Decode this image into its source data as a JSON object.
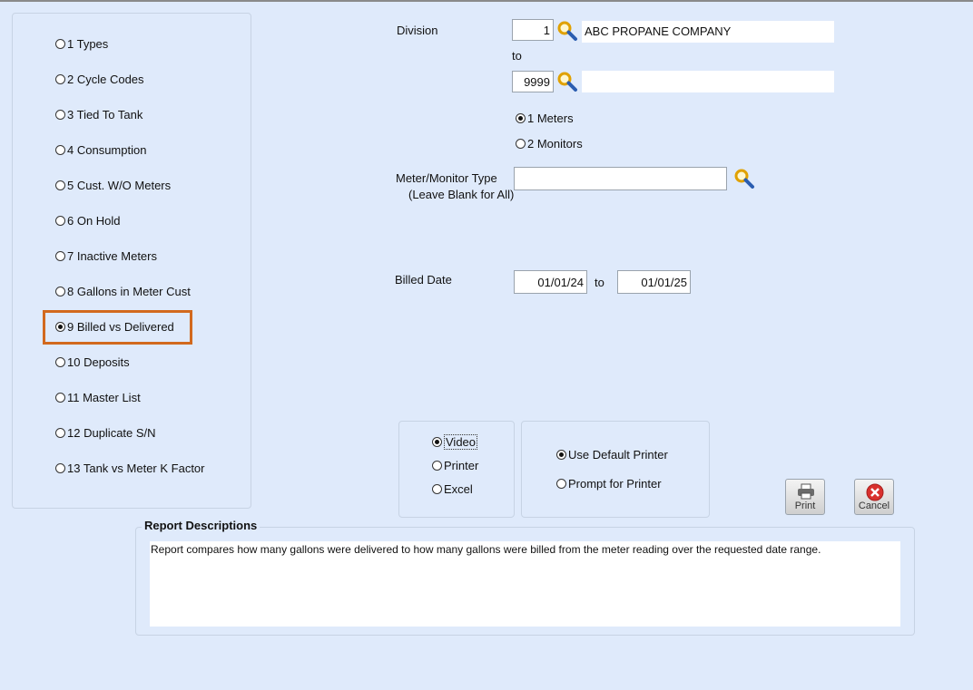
{
  "report_types": [
    {
      "label": "1 Types",
      "selected": false
    },
    {
      "label": "2 Cycle Codes",
      "selected": false
    },
    {
      "label": "3 Tied To Tank",
      "selected": false
    },
    {
      "label": "4 Consumption",
      "selected": false
    },
    {
      "label": "5 Cust. W/O Meters",
      "selected": false
    },
    {
      "label": "6 On Hold",
      "selected": false
    },
    {
      "label": "7 Inactive Meters",
      "selected": false
    },
    {
      "label": "8 Gallons in Meter Cust",
      "selected": false
    },
    {
      "label": "9 Billed vs Delivered",
      "selected": true
    },
    {
      "label": "10 Deposits",
      "selected": false
    },
    {
      "label": "11 Master List",
      "selected": false
    },
    {
      "label": "12 Duplicate S/N",
      "selected": false
    },
    {
      "label": "13 Tank vs Meter K Factor",
      "selected": false
    }
  ],
  "division": {
    "label": "Division",
    "from_value": "1",
    "from_name": "ABC PROPANE COMPANY",
    "to_label": "to",
    "to_value": "9999",
    "to_name": ""
  },
  "meter_mode": {
    "meters_label": "1 Meters",
    "monitors_label": "2 Monitors",
    "selected": "meters"
  },
  "meter_type": {
    "label": "Meter/Monitor Type",
    "hint": "(Leave Blank for All)",
    "value": ""
  },
  "billed_date": {
    "label": "Billed Date",
    "from": "01/01/24",
    "to_label": "to",
    "to": "01/01/25"
  },
  "output": {
    "video_label": "Video",
    "printer_label": "Printer",
    "excel_label": "Excel",
    "selected": "video"
  },
  "printer_option": {
    "default_label": "Use Default Printer",
    "prompt_label": "Prompt for Printer",
    "selected": "default"
  },
  "buttons": {
    "print_label": "Print",
    "cancel_label": "Cancel"
  },
  "description": {
    "title": "Report Descriptions",
    "text": "Report compares how many gallons were delivered to how many gallons were billed from the meter reading over the requested date range."
  },
  "colors": {
    "background": "#dfeafb",
    "highlight": "#d2691e",
    "cancel_red": "#d9302c"
  }
}
